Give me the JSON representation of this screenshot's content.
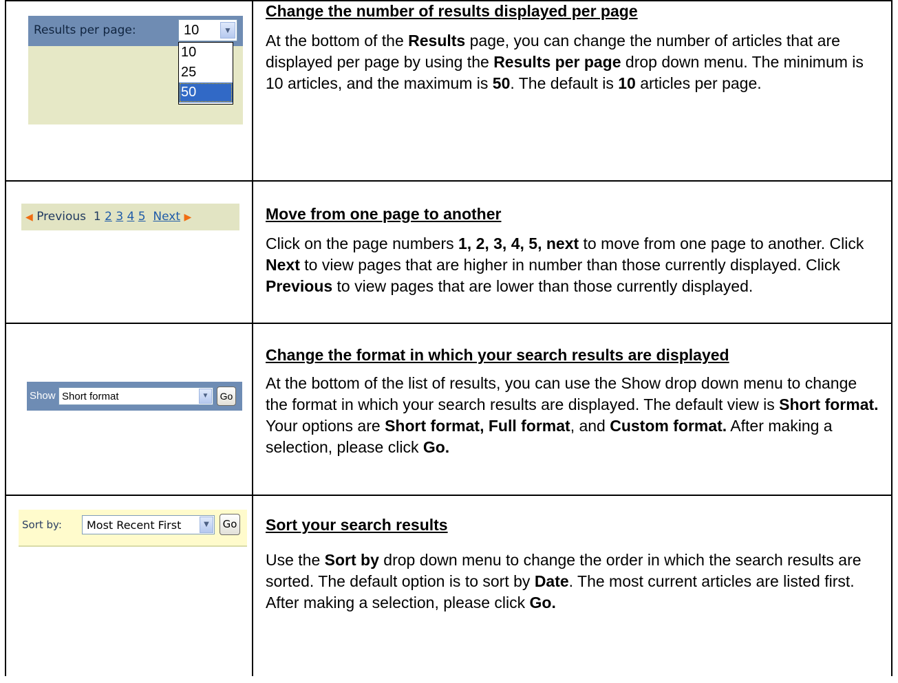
{
  "rows": [
    {
      "widget": {
        "label": "Results per page:",
        "selected": "10",
        "options": [
          "10",
          "25",
          "50"
        ],
        "highlighted_option": "50",
        "dropdown_icon": "chevron-down-icon"
      },
      "title": "Change the number of results displayed per page",
      "desc": [
        {
          "t": "At the bottom of the ",
          "b": false
        },
        {
          "t": "Results",
          "b": true
        },
        {
          "t": " page, you can change the number of articles that are displayed per page by using the ",
          "b": false
        },
        {
          "t": "Results per page",
          "b": true
        },
        {
          "t": " drop down menu.   The minimum is 10 articles, and the maximum is ",
          "b": false
        },
        {
          "t": "50",
          "b": true
        },
        {
          "t": ". The default is ",
          "b": false
        },
        {
          "t": "10",
          "b": true
        },
        {
          "t": " articles per page.",
          "b": false
        }
      ]
    },
    {
      "widget": {
        "previous": "Previous",
        "current_page": "1",
        "pages": [
          "2",
          "3",
          "4",
          "5"
        ],
        "next": "Next",
        "prev_icon": "triangle-left-icon",
        "next_icon": "triangle-right-icon"
      },
      "title": "Move from one page to another",
      "desc": [
        {
          "t": "Click on the page numbers ",
          "b": false
        },
        {
          "t": "1, 2, 3, 4, 5, next",
          "b": true
        },
        {
          "t": "  to move from one page to another.  Click ",
          "b": false
        },
        {
          "t": "Next",
          "b": true
        },
        {
          "t": " to view pages that are higher in number than those currently displayed.  Click ",
          "b": false
        },
        {
          "t": "Previous",
          "b": true
        },
        {
          "t": " to view pages that are lower than those currently displayed.",
          "b": false
        }
      ]
    },
    {
      "widget": {
        "label": "Show",
        "selected": "Short format",
        "go": "Go",
        "dropdown_icon": "chevron-down-icon"
      },
      "title": "Change the format in which your search results are displayed",
      "desc": [
        {
          "t": "At the bottom of the list of results, you can use the Show drop down menu to change the format in which your search results are displayed. The default view is ",
          "b": false
        },
        {
          "t": "Short format.",
          "b": true
        },
        {
          "t": "  Your options are ",
          "b": false
        },
        {
          "t": "Short format, Full format",
          "b": true
        },
        {
          "t": ", and ",
          "b": false
        },
        {
          "t": "Custom format.",
          "b": true
        },
        {
          "t": "  After making a selection, please click ",
          "b": false
        },
        {
          "t": "Go.",
          "b": true
        }
      ]
    },
    {
      "widget": {
        "label": "Sort by:",
        "selected": "Most Recent First",
        "go": "Go",
        "dropdown_icon": "chevron-down-icon"
      },
      "title": "Sort your search results",
      "desc": [
        {
          "t": "Use the ",
          "b": false
        },
        {
          "t": "Sort by",
          "b": true
        },
        {
          "t": " drop down menu to change the order in which the search results are sorted.  The default option is to sort by ",
          "b": false
        },
        {
          "t": "Date",
          "b": true
        },
        {
          "t": ".  The most current articles are listed first. After making a selection, please click ",
          "b": false
        },
        {
          "t": "Go.",
          "b": true
        }
      ]
    }
  ],
  "colors": {
    "widget1_bar": "#6f8cb3",
    "widget1_bg": "#e6e8c6",
    "pager_bg": "#e2e4c3",
    "link": "#1f5ba8",
    "arrow": "#f06d12",
    "widget3_bar": "#6e8cb4",
    "widget4_bg": "#fffbcc",
    "selected_option": "#3169c6"
  }
}
